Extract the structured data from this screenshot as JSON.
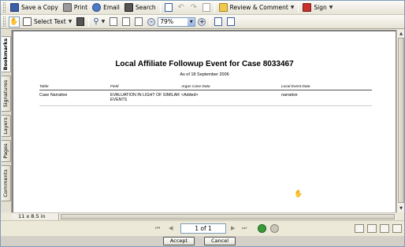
{
  "toolbar": {
    "save_copy": "Save a Copy",
    "print": "Print",
    "email": "Email",
    "search": "Search",
    "review_comment": "Review & Comment",
    "sign": "Sign",
    "select_text": "Select Text",
    "zoom_value": "79%"
  },
  "side_tabs": [
    "Bookmarks",
    "Signatures",
    "Layers",
    "Pages",
    "Comments"
  ],
  "document": {
    "title": "Local Affiliate Followup Event for Case 8033467",
    "subtitle": "As of 18 September 2006",
    "columns": [
      "Table",
      "Field",
      "Argus Case Data",
      "Local Event Data"
    ],
    "rows": [
      {
        "table": "Case Narrative",
        "field": "EVALUATION IN LIGHT OF SIMILAR EVENTS",
        "argus_data": "<Added>",
        "local_data": "narrative"
      }
    ]
  },
  "status": {
    "page_size": "11 x 8.5 in"
  },
  "navigation": {
    "page_indicator": "1 of 1"
  },
  "buttons": {
    "accept": "Accept",
    "cancel": "Cancel"
  }
}
